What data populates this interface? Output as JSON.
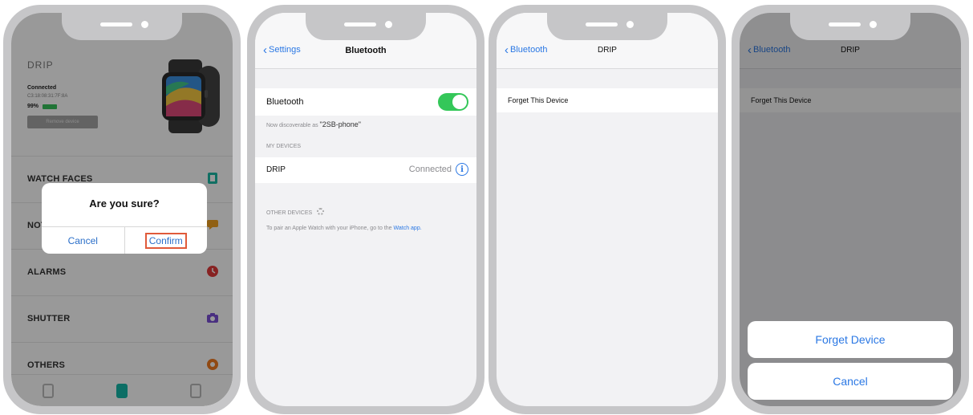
{
  "panel1": {
    "device_name": "DRIP",
    "status": "Connected",
    "mac": "C3:18:08:31:7F:8A",
    "battery": "99%",
    "battery_level": 0.99,
    "unbind_label": "Remove device",
    "menu": [
      {
        "label": "WATCH FACES",
        "icon": "watch-face-icon",
        "color": "#1db9a6"
      },
      {
        "label": "NOT",
        "icon": "message-icon",
        "color": "#f0a020"
      },
      {
        "label": "ALARMS",
        "icon": "alarm-icon",
        "color": "#e23a3a"
      },
      {
        "label": "SHUTTER",
        "icon": "camera-icon",
        "color": "#7b4fd6"
      },
      {
        "label": "OTHERS",
        "icon": "gear-icon",
        "color": "#f07a20"
      }
    ],
    "dialog": {
      "title": "Are you sure?",
      "cancel": "Cancel",
      "confirm": "Confirm"
    }
  },
  "panel2": {
    "back_label": "Settings",
    "title": "Bluetooth",
    "bluetooth_label": "Bluetooth",
    "bluetooth_on": true,
    "discoverable_prefix": "Now discoverable as",
    "discoverable_name": "\"2SB-phone\"",
    "my_devices_header": "MY DEVICES",
    "device_name": "DRIP",
    "device_status": "Connected",
    "other_devices_header": "OTHER DEVICES",
    "pair_note": "To pair an Apple Watch with your iPhone, go to the",
    "pair_link": "Watch app."
  },
  "panel3": {
    "back_label": "Bluetooth",
    "title": "DRIP",
    "forget_label": "Forget This Device"
  },
  "panel4": {
    "back_label": "Bluetooth",
    "title": "DRIP",
    "forget_label": "Forget This Device",
    "sheet_forget": "Forget Device",
    "sheet_cancel": "Cancel"
  },
  "colors": {
    "ios_blue": "#2b78e4",
    "toggle_green": "#34c759",
    "confirm_outline": "#e05a3a"
  }
}
